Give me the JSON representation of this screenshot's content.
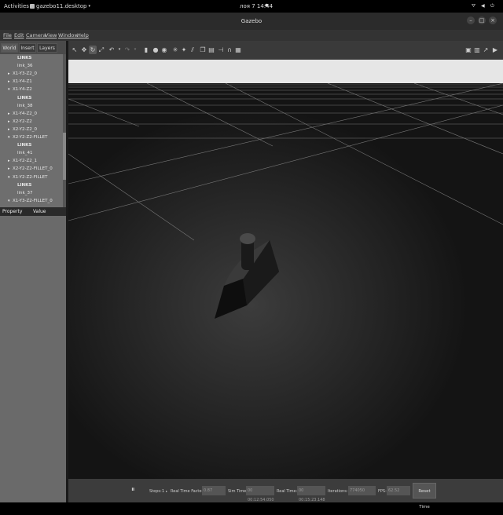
{
  "system_bar": {
    "activities": "Activities",
    "app_name": "gazebo11.desktop",
    "clock": "лоя 7 14:44"
  },
  "window": {
    "title": "Gazebo"
  },
  "menu": [
    "File",
    "Edit",
    "Camera",
    "View",
    "Window",
    "Help"
  ],
  "left_panel": {
    "tabs": [
      "World",
      "Insert",
      "Layers"
    ],
    "tree": [
      {
        "text": "LINKS",
        "indent": 22,
        "header": true,
        "tri": ""
      },
      {
        "text": "link_36",
        "indent": 22,
        "tri": ""
      },
      {
        "text": "X1-Y3-Z2_0",
        "indent": 16,
        "tri": "▸"
      },
      {
        "text": "X1-Y4-Z1",
        "indent": 16,
        "tri": "▸"
      },
      {
        "text": "X1-Y4-Z2",
        "indent": 16,
        "tri": "▾"
      },
      {
        "text": "LINKS",
        "indent": 22,
        "header": true,
        "tri": ""
      },
      {
        "text": "link_38",
        "indent": 22,
        "tri": ""
      },
      {
        "text": "X1-Y4-Z2_0",
        "indent": 16,
        "tri": "▸"
      },
      {
        "text": "X2-Y2-Z2",
        "indent": 16,
        "tri": "▸"
      },
      {
        "text": "X2-Y2-Z2_0",
        "indent": 16,
        "tri": "▸"
      },
      {
        "text": "X2-Y2-Z2-FILLET",
        "indent": 16,
        "tri": "▾"
      },
      {
        "text": "LINKS",
        "indent": 22,
        "header": true,
        "tri": ""
      },
      {
        "text": "link_41",
        "indent": 22,
        "tri": ""
      },
      {
        "text": "X1-Y2-Z2_1",
        "indent": 16,
        "tri": "▸"
      },
      {
        "text": "X2-Y2-Z2-FILLET_0",
        "indent": 16,
        "tri": "▸"
      },
      {
        "text": "X1-Y2-Z2-FILLET",
        "indent": 16,
        "tri": "▾"
      },
      {
        "text": "LINKS",
        "indent": 22,
        "header": true,
        "tri": ""
      },
      {
        "text": "link_37",
        "indent": 22,
        "tri": ""
      },
      {
        "text": "X1-Y3-Z2-FILLET_0",
        "indent": 16,
        "tri": "▾"
      }
    ],
    "property_header": {
      "property": "Property",
      "value": "Value"
    }
  },
  "bottom_bar": {
    "steps_label": "Steps:",
    "steps_value": "1",
    "real_time_factor_label": "Real Time Factor:",
    "real_time_factor_value": "0.87",
    "sim_time_label": "Sim Time:",
    "sim_time_value": "00 00:12:54.050",
    "real_time_label": "Real Time:",
    "real_time_value": "00 00:15:23.148",
    "iterations_label": "Iterations:",
    "iterations_value": "774050",
    "fps_label": "FPS:",
    "fps_value": "62.52",
    "reset_label": "Reset Time"
  },
  "colors": {
    "panel": "#4a4a4a",
    "tree_bg": "#6e6e6e",
    "toolbar": "#3a3a3a",
    "sky": "#e6e6e6",
    "ground": "#2a2a2a"
  }
}
